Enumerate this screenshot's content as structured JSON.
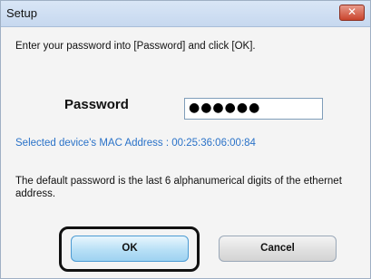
{
  "window": {
    "title": "Setup",
    "close_label": "✕"
  },
  "dialog": {
    "instruction": "Enter your password into [Password] and click [OK].",
    "password_label": "Password",
    "password_value": "●●●●●●",
    "mac_text": "Selected device's MAC Address : 00:25:36:06:00:84",
    "note": "The default password is the last 6 alphanumerical digits of the ethernet address."
  },
  "buttons": {
    "ok_label": "OK",
    "cancel_label": "Cancel"
  }
}
